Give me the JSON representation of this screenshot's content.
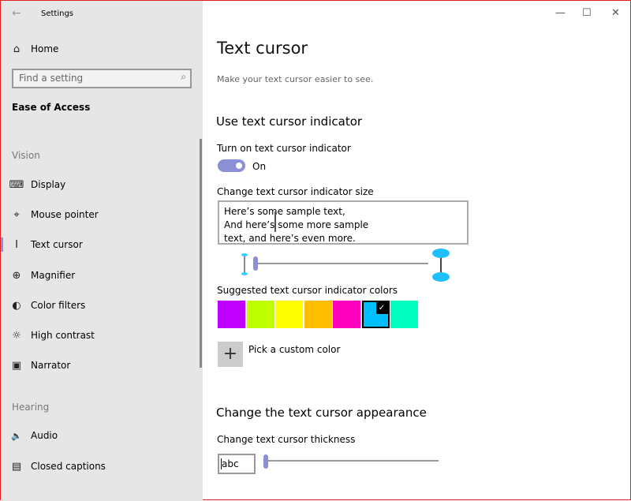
{
  "window": {
    "title": "Settings",
    "back_icon": "←",
    "minimize": "—",
    "maximize": "☐",
    "close": "✕"
  },
  "sidebar": {
    "home": "Home",
    "search_placeholder": "Find a setting",
    "section": "Ease of Access",
    "groups": [
      {
        "label": "Vision",
        "items": [
          {
            "icon": "⌨",
            "label": "Display"
          },
          {
            "icon": "⌖",
            "label": "Mouse pointer"
          },
          {
            "icon": "I",
            "label": "Text cursor"
          },
          {
            "icon": "⊕",
            "label": "Magnifier"
          },
          {
            "icon": "◐",
            "label": "Color filters"
          },
          {
            "icon": "☼",
            "label": "High contrast"
          },
          {
            "icon": "▣",
            "label": "Narrator"
          }
        ]
      },
      {
        "label": "Hearing",
        "items": [
          {
            "icon": "🔈",
            "label": "Audio"
          },
          {
            "icon": "▤",
            "label": "Closed captions"
          }
        ]
      }
    ]
  },
  "main": {
    "title": "Text cursor",
    "subtitle": "Make your text cursor easier to see.",
    "indicator_heading": "Use text cursor indicator",
    "toggle_label": "Turn on text cursor indicator",
    "toggle_state": "On",
    "size_label": "Change text cursor indicator size",
    "sample_lines": [
      "Here’s some sample text,",
      "And here’s some more sample",
      "text, and here’s even more."
    ],
    "size_value": 0.0,
    "colors_label": "Suggested text cursor indicator colors",
    "colors": [
      "#bf00ff",
      "#bfff00",
      "#ffff00",
      "#ffbf00",
      "#ff00bf",
      "#00bfff",
      "#00ffbf"
    ],
    "selected_color": "#00bfff",
    "custom_color": "Pick a custom color",
    "appearance_heading": "Change the text cursor appearance",
    "thickness_label": "Change text cursor thickness",
    "thickness_preview": "abc",
    "thickness_value": 0.0,
    "accent": "#8a8fd6"
  }
}
